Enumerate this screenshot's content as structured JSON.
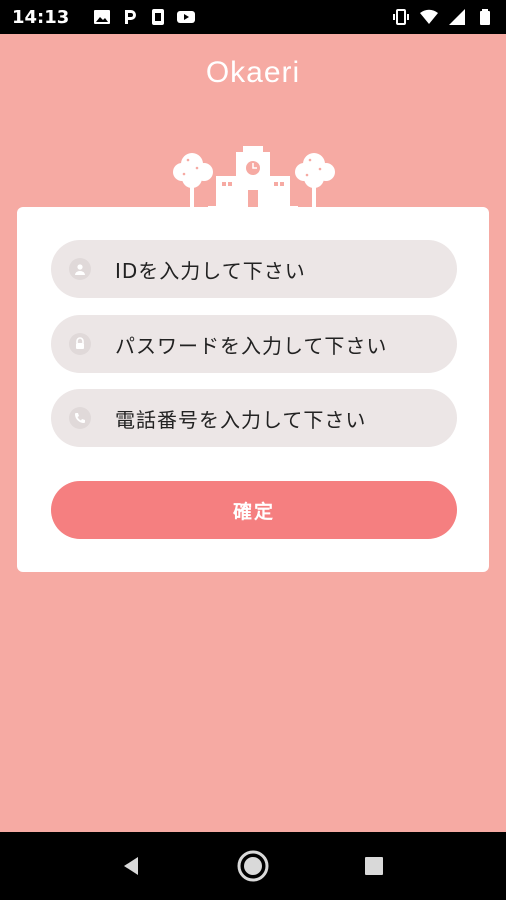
{
  "status_bar": {
    "time": "14:13",
    "left_icons": [
      "image-icon",
      "parking-icon",
      "sim-icon",
      "youtube-icon"
    ],
    "right_icons": [
      "vibrate-icon",
      "wifi-icon",
      "signal-icon",
      "battery-icon"
    ]
  },
  "app": {
    "logo": "Okaeri",
    "fields": {
      "id_placeholder": "IDを入力して下さい",
      "password_placeholder": "パスワードを入力して下さい",
      "phone_placeholder": "電話番号を入力して下さい"
    },
    "confirm_label": "確定"
  },
  "colors": {
    "background": "#f6aaa3",
    "button": "#f57f80",
    "field": "#ece6e6",
    "card": "#ffffff"
  },
  "nav_bar": {
    "icons": [
      "back-icon",
      "home-icon",
      "recents-icon"
    ]
  }
}
